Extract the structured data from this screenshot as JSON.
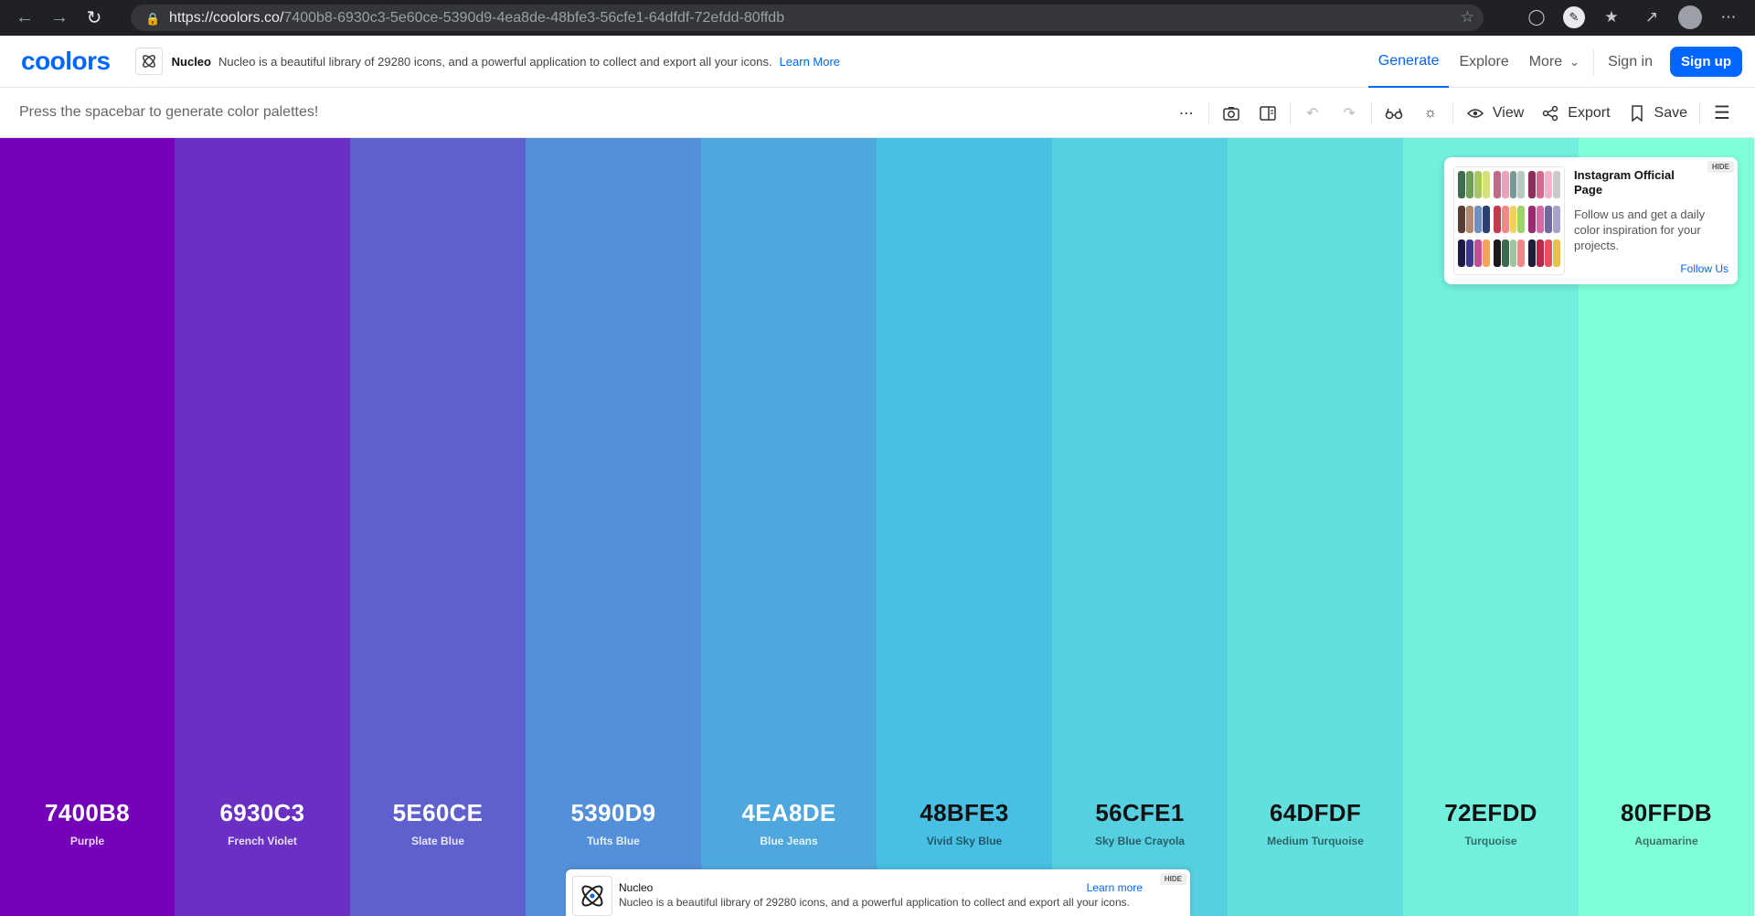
{
  "browser": {
    "url_host": "https://coolors.co/",
    "url_path": "7400b8-6930c3-5e60ce-5390d9-4ea8de-48bfe3-56cfe1-64dfdf-72efdd-80ffdb"
  },
  "header": {
    "logo": "coolors",
    "ad_brand": "Nucleo",
    "ad_text": "Nucleo is a beautiful library of 29280 icons, and a powerful application to collect and export all your icons.",
    "ad_link": "Learn More",
    "nav": {
      "generate": "Generate",
      "explore": "Explore",
      "more": "More",
      "signin": "Sign in",
      "signup": "Sign up"
    }
  },
  "toolbar": {
    "hint": "Press the spacebar to generate color palettes!",
    "view": "View",
    "export": "Export",
    "save": "Save"
  },
  "palette": [
    {
      "hex": "7400B8",
      "name": "Purple",
      "color": "#7400b8",
      "text": "light"
    },
    {
      "hex": "6930C3",
      "name": "French Violet",
      "color": "#6930c3",
      "text": "light"
    },
    {
      "hex": "5E60CE",
      "name": "Slate Blue",
      "color": "#5e60ce",
      "text": "light"
    },
    {
      "hex": "5390D9",
      "name": "Tufts Blue",
      "color": "#5390d9",
      "text": "light"
    },
    {
      "hex": "4EA8DE",
      "name": "Blue Jeans",
      "color": "#4ea8de",
      "text": "light"
    },
    {
      "hex": "48BFE3",
      "name": "Vivid Sky Blue",
      "color": "#48bfe3",
      "text": "dark"
    },
    {
      "hex": "56CFE1",
      "name": "Sky Blue Crayola",
      "color": "#56cfe1",
      "text": "dark"
    },
    {
      "hex": "64DFDF",
      "name": "Medium Turquoise",
      "color": "#64dfdf",
      "text": "dark"
    },
    {
      "hex": "72EFDD",
      "name": "Turquoise",
      "color": "#72efdd",
      "text": "dark"
    },
    {
      "hex": "80FFDB",
      "name": "Aquamarine",
      "color": "#80ffdb",
      "text": "dark"
    }
  ],
  "instagram_card": {
    "title": "Instagram Official Page",
    "description": "Follow us and get a daily color inspiration for your projects.",
    "link": "Follow Us",
    "hide": "HIDE"
  },
  "bottom_ad": {
    "title": "Nucleo",
    "description": "Nucleo is a beautiful library of 29280 icons, and a powerful application to collect and export all your icons.",
    "link": "Learn more",
    "hide": "HIDE"
  }
}
